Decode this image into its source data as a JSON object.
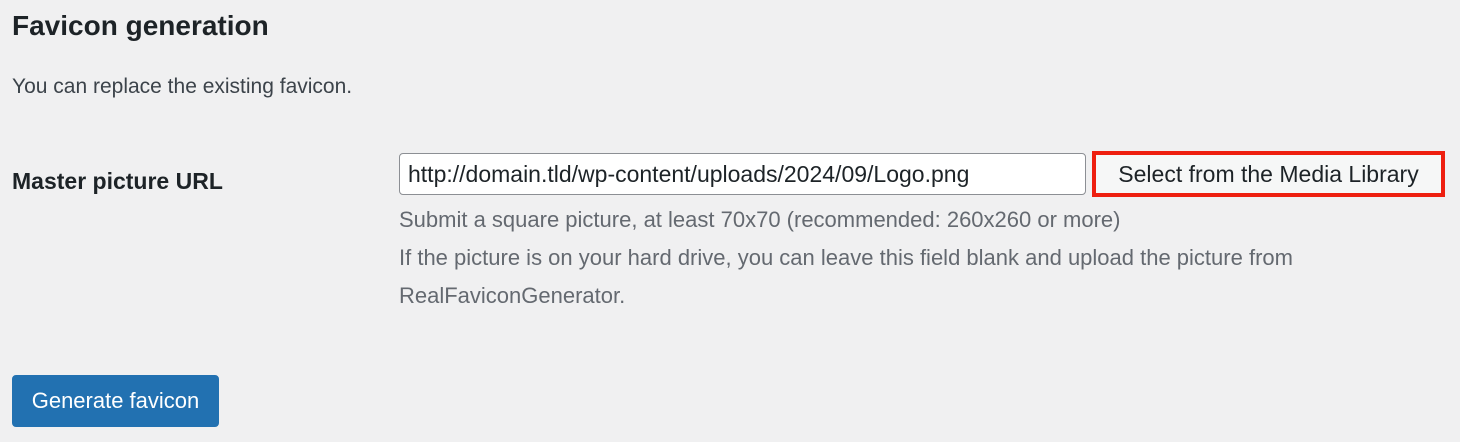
{
  "section": {
    "title": "Favicon generation",
    "description": "You can replace the existing favicon."
  },
  "master_picture": {
    "label": "Master picture URL",
    "url_value": "http://domain.tld/wp-content/uploads/2024/09/Logo.png",
    "media_button_label": "Select from the Media Library",
    "media_button_highlight_color": "#ee1f10",
    "help_lines": [
      "Submit a square picture, at least 70x70 (recommended: 260x260 or more)",
      "If the picture is on your hard drive, you can leave this field blank and upload the picture from",
      "RealFaviconGenerator."
    ]
  },
  "actions": {
    "generate_label": "Generate favicon",
    "generate_color": "#2271b1"
  }
}
